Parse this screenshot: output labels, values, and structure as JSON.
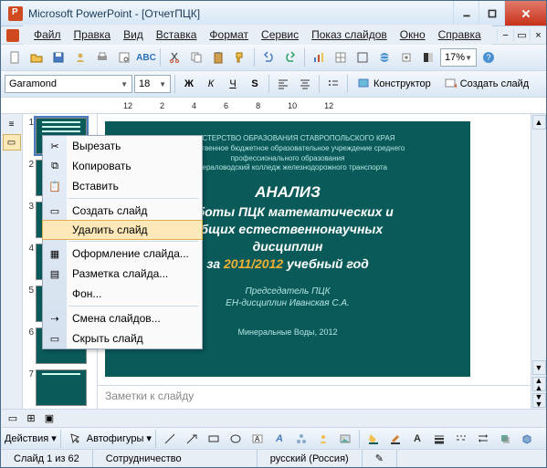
{
  "title": "Microsoft PowerPoint - [ОтчетПЦК]",
  "menus": [
    "Файл",
    "Правка",
    "Вид",
    "Вставка",
    "Формат",
    "Сервис",
    "Показ слайдов",
    "Окно",
    "Справка"
  ],
  "font": {
    "name": "Garamond",
    "size": "18"
  },
  "zoom": "17%",
  "format_btns": {
    "bold": "Ж",
    "italic": "К",
    "underline": "Ч",
    "shadow": "S"
  },
  "design_label": "Конструктор",
  "newslide_label": "Создать слайд",
  "ruler_ticks": [
    "12",
    "2",
    "4",
    "6",
    "8",
    "10",
    "12"
  ],
  "thumbs": [
    1,
    2,
    3,
    4,
    5,
    6,
    7
  ],
  "slide": {
    "line1": "МИНИСТЕРСТВО ОБРАЗОВАНИЯ СТАВРОПОЛЬСКОГО КРАЯ",
    "line2": "Государственное бюджетное образовательное учреждение среднего",
    "line3": "профессионального образования",
    "line4": "Минераловодский колледж железнодорожного транспорта",
    "h1": "АНАЛИЗ",
    "h2": "работы ПЦК математических и",
    "h3": "общих естественнонаучных",
    "h4": "дисциплин",
    "h5a": "за ",
    "h5b": "2011/2012",
    "h5c": " учебный год",
    "f1": "Председатель ПЦК",
    "f2": "ЕН-дисциплин Иванская С.А.",
    "loc": "Минеральные Воды, 2012"
  },
  "notes_placeholder": "Заметки к слайду",
  "draw": {
    "actions": "Действия",
    "autoshapes": "Автофигуры"
  },
  "status": {
    "slide": "Слайд 1 из 62",
    "design": "Сотрудничество",
    "lang": "русский (Россия)"
  },
  "context": {
    "cut": "Вырезать",
    "copy": "Копировать",
    "paste": "Вставить",
    "newslide": "Создать слайд",
    "delete": "Удалить слайд",
    "design": "Оформление слайда...",
    "layout": "Разметка слайда...",
    "background": "Фон...",
    "transition": "Смена слайдов...",
    "hide": "Скрыть слайд"
  }
}
